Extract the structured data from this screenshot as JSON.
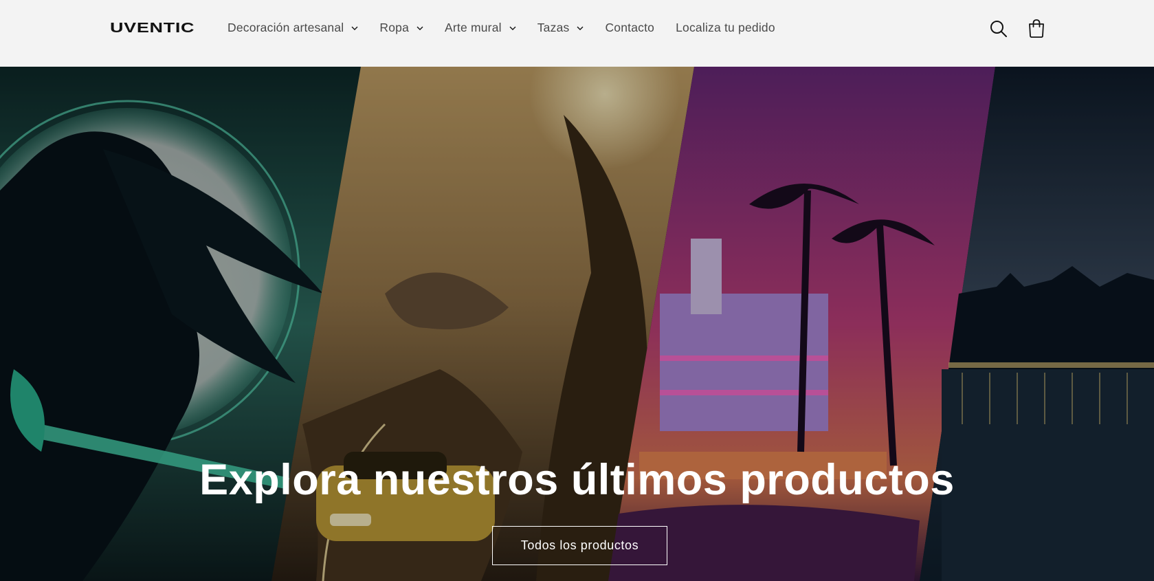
{
  "header": {
    "logo": "UVENTIC",
    "nav": [
      {
        "label": "Decoración artesanal",
        "has_dropdown": true
      },
      {
        "label": "Ropa",
        "has_dropdown": true
      },
      {
        "label": "Arte mural",
        "has_dropdown": true
      },
      {
        "label": "Tazas",
        "has_dropdown": true
      },
      {
        "label": "Contacto",
        "has_dropdown": false
      },
      {
        "label": "Localiza tu pedido",
        "has_dropdown": false
      }
    ],
    "icons": {
      "search": "search-icon",
      "cart": "cart-icon",
      "dropdown": "chevron-down-icon"
    }
  },
  "hero": {
    "title": "Explora nuestros últimos productos",
    "button_label": "Todos los productos",
    "panels": [
      "anime-warrior",
      "mountain-road-car",
      "miami-sunset-palms",
      "night-harbor-city"
    ]
  },
  "colors": {
    "header_bg": "#f3f3f3",
    "text": "#121212",
    "nav_text": "#4a4a4a",
    "hero_text": "#ffffff"
  }
}
